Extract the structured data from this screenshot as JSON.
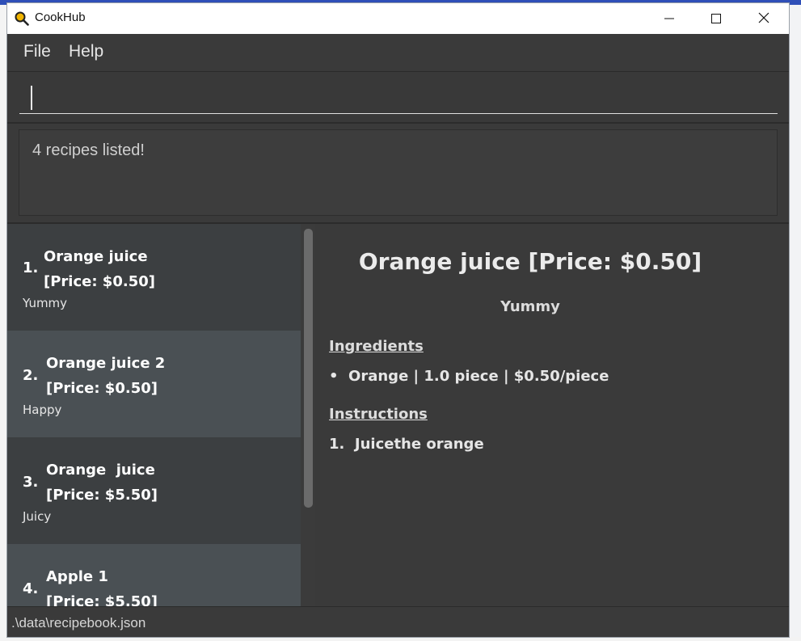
{
  "window": {
    "title": "CookHub",
    "icons": {
      "app": "magnifier-app-icon",
      "minimize": "minimize-icon",
      "maximize": "maximize-icon",
      "close": "close-icon"
    }
  },
  "menu": {
    "items": [
      "File",
      "Help"
    ]
  },
  "command": {
    "value": "",
    "placeholder": ""
  },
  "result": {
    "message": "4 recipes listed!"
  },
  "recipes": [
    {
      "index": "1.",
      "name": "Orange juice",
      "price": "[Price: $0.50]",
      "description": "Yummy"
    },
    {
      "index": "2.",
      "name": "Orange juice 2",
      "price": "[Price: $0.50]",
      "description": "Happy"
    },
    {
      "index": "3.",
      "name": "Orange  juice",
      "price": "[Price: $5.50]",
      "description": "Juicy"
    },
    {
      "index": "4.",
      "name": "Apple 1",
      "price": "[Price: $5.50]",
      "description": ""
    }
  ],
  "detail": {
    "title": "Orange juice [Price: $0.50]",
    "description": "Yummy",
    "ingredients_heading": "Ingredients",
    "ingredients": [
      "•  Orange | 1.0 piece | $0.50/piece"
    ],
    "instructions_heading": "Instructions",
    "instructions": [
      "1.  Juicethe orange"
    ]
  },
  "status": {
    "path": ".\\data\\recipebook.json"
  },
  "colors": {
    "background": "#3b3b3b",
    "card_dark": "#3c3f41",
    "card_light": "#4a5054",
    "text": "#ffffff"
  }
}
